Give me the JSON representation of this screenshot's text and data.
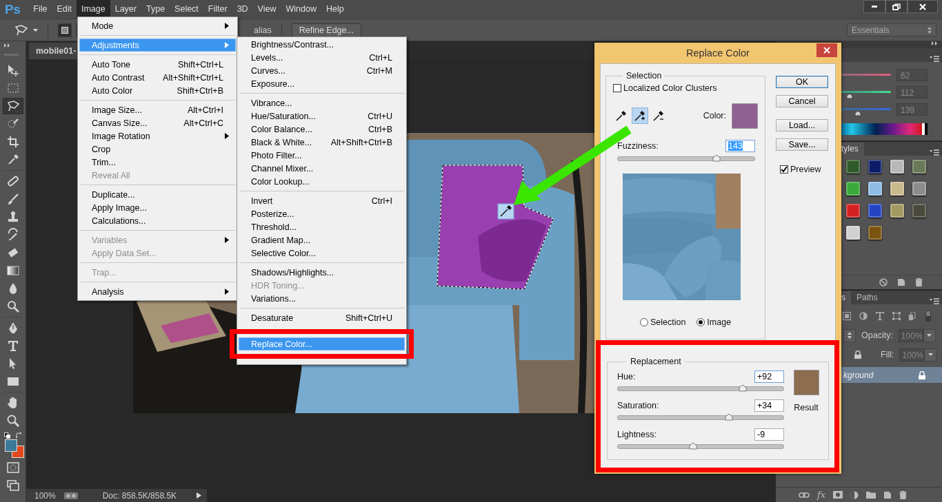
{
  "app": {
    "logo": "Ps"
  },
  "menubar": [
    {
      "label": "File",
      "selected": false
    },
    {
      "label": "Edit",
      "selected": false
    },
    {
      "label": "Image",
      "selected": true
    },
    {
      "label": "Layer",
      "selected": false
    },
    {
      "label": "Type",
      "selected": false
    },
    {
      "label": "Select",
      "selected": false
    },
    {
      "label": "Filter",
      "selected": false
    },
    {
      "label": "3D",
      "selected": false
    },
    {
      "label": "View",
      "selected": false
    },
    {
      "label": "Window",
      "selected": false
    },
    {
      "label": "Help",
      "selected": false
    }
  ],
  "options_bar": {
    "partial_label": "alias",
    "refine_edge": "Refine Edge...",
    "workspace": "Essentials"
  },
  "document_tab": {
    "title": "mobile01-"
  },
  "tools": [
    {
      "kind": "move",
      "selected": false
    },
    {
      "kind": "marquee",
      "selected": false
    },
    {
      "kind": "lasso",
      "selected": true
    },
    {
      "kind": "quick-select",
      "selected": false
    },
    {
      "kind": "crop",
      "selected": false
    },
    {
      "kind": "eyedropper",
      "selected": false
    },
    {
      "kind": "separator"
    },
    {
      "kind": "healing",
      "selected": false
    },
    {
      "kind": "brush",
      "selected": false
    },
    {
      "kind": "stamp",
      "selected": false
    },
    {
      "kind": "history",
      "selected": false
    },
    {
      "kind": "eraser",
      "selected": false
    },
    {
      "kind": "gradient",
      "selected": false
    },
    {
      "kind": "blur",
      "selected": false
    },
    {
      "kind": "dodge",
      "selected": false
    },
    {
      "kind": "separator"
    },
    {
      "kind": "pen",
      "selected": false
    },
    {
      "kind": "type",
      "selected": false
    },
    {
      "kind": "path-select",
      "selected": false
    },
    {
      "kind": "shape",
      "selected": false
    },
    {
      "kind": "separator"
    },
    {
      "kind": "hand",
      "selected": false
    },
    {
      "kind": "zoom",
      "selected": false
    }
  ],
  "image_menu": [
    {
      "kind": "item",
      "label": "Mode",
      "submenu": true,
      "disabled": false,
      "selected": false
    },
    {
      "kind": "separator"
    },
    {
      "kind": "item",
      "label": "Adjustments",
      "submenu": true,
      "disabled": false,
      "selected": true
    },
    {
      "kind": "separator"
    },
    {
      "kind": "item",
      "label": "Auto Tone",
      "shortcut": "Shift+Ctrl+L",
      "disabled": false,
      "selected": false
    },
    {
      "kind": "item",
      "label": "Auto Contrast",
      "shortcut": "Alt+Shift+Ctrl+L",
      "disabled": false,
      "selected": false
    },
    {
      "kind": "item",
      "label": "Auto Color",
      "shortcut": "Shift+Ctrl+B",
      "disabled": false,
      "selected": false
    },
    {
      "kind": "separator"
    },
    {
      "kind": "item",
      "label": "Image Size...",
      "shortcut": "Alt+Ctrl+I",
      "disabled": false,
      "selected": false
    },
    {
      "kind": "item",
      "label": "Canvas Size...",
      "shortcut": "Alt+Ctrl+C",
      "disabled": false,
      "selected": false
    },
    {
      "kind": "item",
      "label": "Image Rotation",
      "submenu": true,
      "disabled": false,
      "selected": false
    },
    {
      "kind": "item",
      "label": "Crop",
      "disabled": false,
      "selected": false
    },
    {
      "kind": "item",
      "label": "Trim...",
      "disabled": false,
      "selected": false
    },
    {
      "kind": "item",
      "label": "Reveal All",
      "disabled": true,
      "selected": false
    },
    {
      "kind": "separator"
    },
    {
      "kind": "item",
      "label": "Duplicate...",
      "disabled": false,
      "selected": false
    },
    {
      "kind": "item",
      "label": "Apply Image...",
      "disabled": false,
      "selected": false
    },
    {
      "kind": "item",
      "label": "Calculations...",
      "disabled": false,
      "selected": false
    },
    {
      "kind": "separator"
    },
    {
      "kind": "item",
      "label": "Variables",
      "submenu": true,
      "disabled": true,
      "selected": false
    },
    {
      "kind": "item",
      "label": "Apply Data Set...",
      "disabled": true,
      "selected": false
    },
    {
      "kind": "separator"
    },
    {
      "kind": "item",
      "label": "Trap...",
      "disabled": true,
      "selected": false
    },
    {
      "kind": "separator"
    },
    {
      "kind": "item",
      "label": "Analysis",
      "submenu": true,
      "disabled": false,
      "selected": false
    }
  ],
  "adjustments_menu": [
    {
      "kind": "item",
      "label": "Brightness/Contrast...",
      "disabled": false,
      "selected": false
    },
    {
      "kind": "item",
      "label": "Levels...",
      "shortcut": "Ctrl+L",
      "disabled": false,
      "selected": false
    },
    {
      "kind": "item",
      "label": "Curves...",
      "shortcut": "Ctrl+M",
      "disabled": false,
      "selected": false
    },
    {
      "kind": "item",
      "label": "Exposure...",
      "disabled": false,
      "selected": false
    },
    {
      "kind": "separator"
    },
    {
      "kind": "item",
      "label": "Vibrance...",
      "disabled": false,
      "selected": false
    },
    {
      "kind": "item",
      "label": "Hue/Saturation...",
      "shortcut": "Ctrl+U",
      "disabled": false,
      "selected": false
    },
    {
      "kind": "item",
      "label": "Color Balance...",
      "shortcut": "Ctrl+B",
      "disabled": false,
      "selected": false
    },
    {
      "kind": "item",
      "label": "Black & White...",
      "shortcut": "Alt+Shift+Ctrl+B",
      "disabled": false,
      "selected": false
    },
    {
      "kind": "item",
      "label": "Photo Filter...",
      "disabled": false,
      "selected": false
    },
    {
      "kind": "item",
      "label": "Channel Mixer...",
      "disabled": false,
      "selected": false
    },
    {
      "kind": "item",
      "label": "Color Lookup...",
      "disabled": false,
      "selected": false
    },
    {
      "kind": "separator"
    },
    {
      "kind": "item",
      "label": "Invert",
      "shortcut": "Ctrl+I",
      "disabled": false,
      "selected": false
    },
    {
      "kind": "item",
      "label": "Posterize...",
      "disabled": false,
      "selected": false
    },
    {
      "kind": "item",
      "label": "Threshold...",
      "disabled": false,
      "selected": false
    },
    {
      "kind": "item",
      "label": "Gradient Map...",
      "disabled": false,
      "selected": false
    },
    {
      "kind": "item",
      "label": "Selective Color...",
      "disabled": false,
      "selected": false
    },
    {
      "kind": "separator"
    },
    {
      "kind": "item",
      "label": "Shadows/Highlights...",
      "disabled": false,
      "selected": false
    },
    {
      "kind": "item",
      "label": "HDR Toning...",
      "disabled": true,
      "selected": false
    },
    {
      "kind": "item",
      "label": "Variations...",
      "disabled": false,
      "selected": false
    },
    {
      "kind": "separator"
    },
    {
      "kind": "item",
      "label": "Desaturate",
      "shortcut": "Shift+Ctrl+U",
      "disabled": false,
      "selected": false
    },
    {
      "kind": "covered"
    },
    {
      "kind": "item",
      "label": "Replace Color...",
      "disabled": false,
      "selected": true
    },
    {
      "kind": "covered"
    }
  ],
  "dialog": {
    "title": "Replace Color",
    "selection": {
      "legend": "Selection",
      "localized": {
        "label": "Localized Color Clusters",
        "checked": false
      },
      "eyedroppers": [
        {
          "kind": "sample",
          "selected": false
        },
        {
          "kind": "add",
          "selected": true
        },
        {
          "kind": "subtract",
          "selected": false
        }
      ],
      "color_label": "Color:",
      "fuzziness": {
        "label": "Fuzziness:",
        "value": "143",
        "level": 0.72
      },
      "view_options": [
        {
          "label": "Selection",
          "selected": false
        },
        {
          "label": "Image",
          "selected": true
        }
      ]
    },
    "replacement": {
      "legend": "Replacement",
      "sliders": [
        {
          "label": "Hue:",
          "value": "+92",
          "level": 0.755
        },
        {
          "label": "Saturation:",
          "value": "+34",
          "level": 0.67
        },
        {
          "label": "Lightness:",
          "value": "-9",
          "level": 0.455
        }
      ],
      "result_label": "Result"
    },
    "buttons": [
      {
        "label": "OK",
        "default": true
      },
      {
        "label": "Cancel",
        "default": false
      },
      {
        "label": "Load...",
        "default": false
      },
      {
        "label": "Save...",
        "default": false
      }
    ],
    "preview": {
      "label": "Preview",
      "checked": true
    }
  },
  "panels": {
    "color": {
      "channels": [
        {
          "value": "62",
          "level": 0.3
        },
        {
          "value": "112",
          "level": 0.64
        },
        {
          "value": "139",
          "level": 0.71
        }
      ]
    },
    "styles": {
      "tab": "tyles",
      "swatches": [
        {
          "color": "#2f5a2a"
        },
        {
          "color": "#0c1c66"
        },
        {
          "color": "#b8b8b8"
        },
        {
          "color": "#6a7a58"
        },
        {
          "color": "#3aa83a"
        },
        {
          "color": "#8cbce4"
        },
        {
          "color": "#cbb98e"
        },
        {
          "color": "#8c8c8c"
        },
        {
          "color": "#d42222"
        },
        {
          "color": "#2444c4"
        },
        {
          "color": "#a39a62"
        },
        {
          "color": "#4a4a3c"
        },
        {
          "color": "#d0d0d0"
        },
        {
          "color": "#7a5410"
        }
      ]
    },
    "layers": {
      "tabs": [
        {
          "label": "s",
          "selected": true
        },
        {
          "label": "Paths",
          "selected": false
        }
      ],
      "opacity_label": "Opacity:",
      "opacity": "100%",
      "fill_label": "Fill:",
      "fill": "100%",
      "items": [
        {
          "name": "kground",
          "selected": true,
          "locked": true
        }
      ],
      "footer_fx": "fx"
    }
  },
  "status_bar": {
    "zoom": "100%",
    "doc": "Doc: 858.5K/858.5K"
  }
}
